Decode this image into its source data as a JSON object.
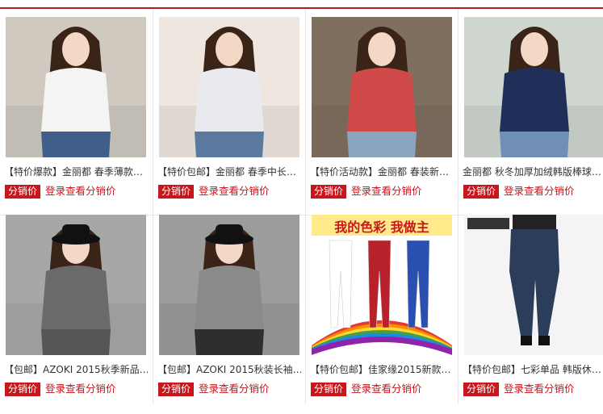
{
  "products": [
    {
      "title": "【特价爆款】金丽都 春季薄款…",
      "tag": "分销价",
      "login_text": "登录查看分销价",
      "image_icon": "woman-white-top-photo",
      "colors": {
        "bg": "#cfc9c0",
        "top": "#f4f4f2",
        "pants": "#3f5f8a"
      }
    },
    {
      "title": "【特价包邮】金丽都 春季中长…",
      "tag": "分销价",
      "login_text": "登录查看分销价",
      "image_icon": "woman-striped-top-photo",
      "colors": {
        "bg": "#efe6df",
        "top": "#e9eaf0",
        "pants": "#5b7aa0"
      }
    },
    {
      "title": "【特价活动款】金丽都 春装新…",
      "tag": "分销价",
      "login_text": "登录查看分销价",
      "image_icon": "woman-patterned-top-photo",
      "colors": {
        "bg": "#7f6f5f",
        "top": "#d04a4a",
        "pants": "#8aa4c0"
      }
    },
    {
      "title": "金丽都 秋冬加厚加绒韩版棒球…",
      "tag": "分销价",
      "login_text": "登录查看分销价",
      "image_icon": "woman-navy-sweater-photo",
      "colors": {
        "bg": "#cfd6d0",
        "top": "#1f2f5a",
        "pants": "#6f8fb5"
      }
    },
    {
      "title": "【包邮】AZOKI 2015秋季新品…",
      "tag": "分销价",
      "login_text": "登录查看分销价",
      "image_icon": "woman-grey-top-hat-photo",
      "colors": {
        "bg": "#a7a7a7",
        "top": "#6a6a6a",
        "pants": "#555555"
      }
    },
    {
      "title": "【包邮】AZOKI 2015秋装长袖…",
      "tag": "分销价",
      "login_text": "登录查看分销价",
      "image_icon": "woman-grey-sweater-hat-photo",
      "colors": {
        "bg": "#9c9c9c",
        "top": "#8a8a8a",
        "pants": "#2e2e2e"
      }
    },
    {
      "title": "【特价包邮】佳家缘2015新款…",
      "tag": "分销价",
      "login_text": "登录查看分销价",
      "image_icon": "colorful-leggings-photo",
      "colors": {
        "bg": "#ffffff",
        "top": "#f7e24a",
        "pants": "#b8202a"
      },
      "banner": "我的色彩 我做主"
    },
    {
      "title": "【特价包邮】七彩单品 韩版休…",
      "tag": "分销价",
      "login_text": "登录查看分销价",
      "image_icon": "denim-harem-pants-photo",
      "colors": {
        "bg": "#f4f4f4",
        "top": "#222222",
        "pants": "#2b3d5a"
      }
    }
  ]
}
